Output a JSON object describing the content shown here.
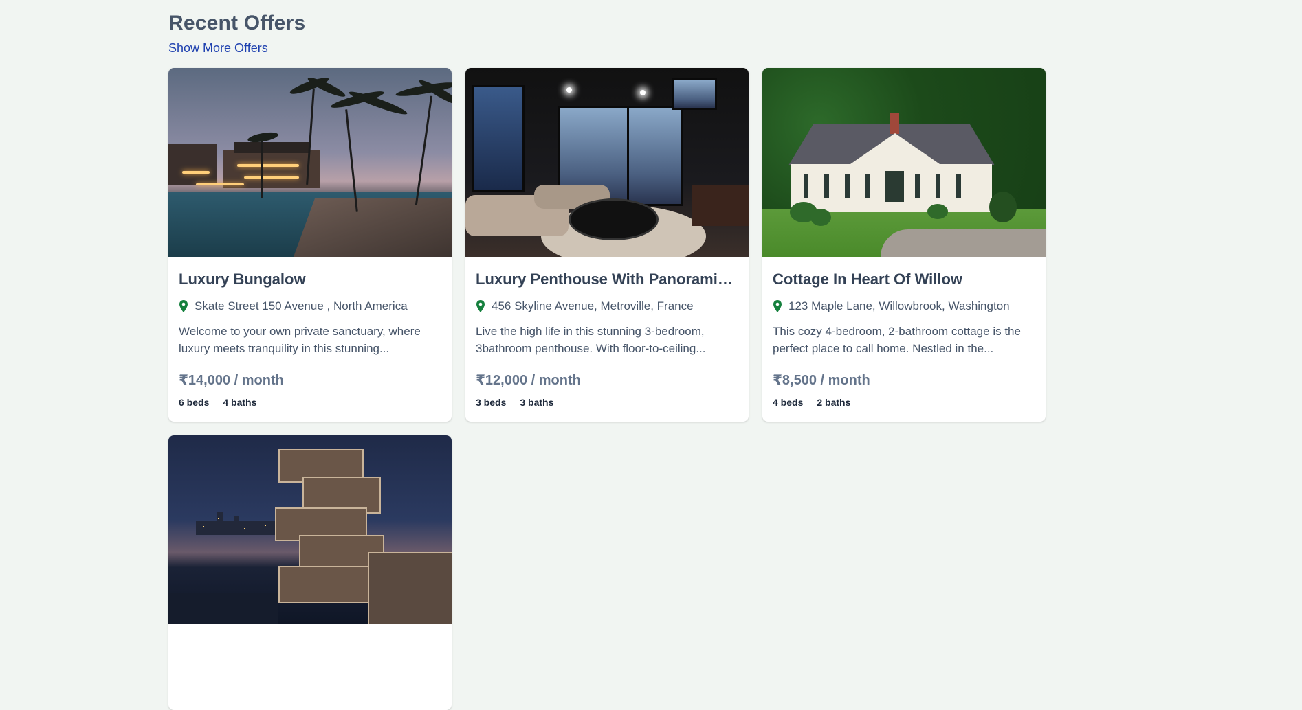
{
  "section": {
    "title": "Recent Offers",
    "more_link": "Show More Offers"
  },
  "listings": [
    {
      "title": "Luxury Bungalow",
      "location": "Skate Street 150 Avenue , North America",
      "description": "Welcome to your own private sanctuary, where luxury meets tranquility in this stunning...",
      "price": "₹14,000 / month",
      "beds": "6 beds",
      "baths": "4 baths"
    },
    {
      "title": "Luxury Penthouse With Panoramic ...",
      "location": "456 Skyline Avenue, Metroville, France",
      "description": "Live the high life in this stunning 3-bedroom, 3bathroom penthouse. With floor-to-ceiling...",
      "price": "₹12,000 / month",
      "beds": "3 beds",
      "baths": "3 baths"
    },
    {
      "title": "Cottage In Heart Of Willow",
      "location": "123 Maple Lane, Willowbrook, Washington",
      "description": "This cozy 4-bedroom, 2-bathroom cottage is the perfect place to call home. Nestled in the...",
      "price": "₹8,500 / month",
      "beds": "4 beds",
      "baths": "2 baths"
    }
  ],
  "colors": {
    "background": "#f1f5f2",
    "link": "#1e40af",
    "location_pin": "#15803d"
  },
  "icons": {
    "location": "map-pin-icon"
  }
}
